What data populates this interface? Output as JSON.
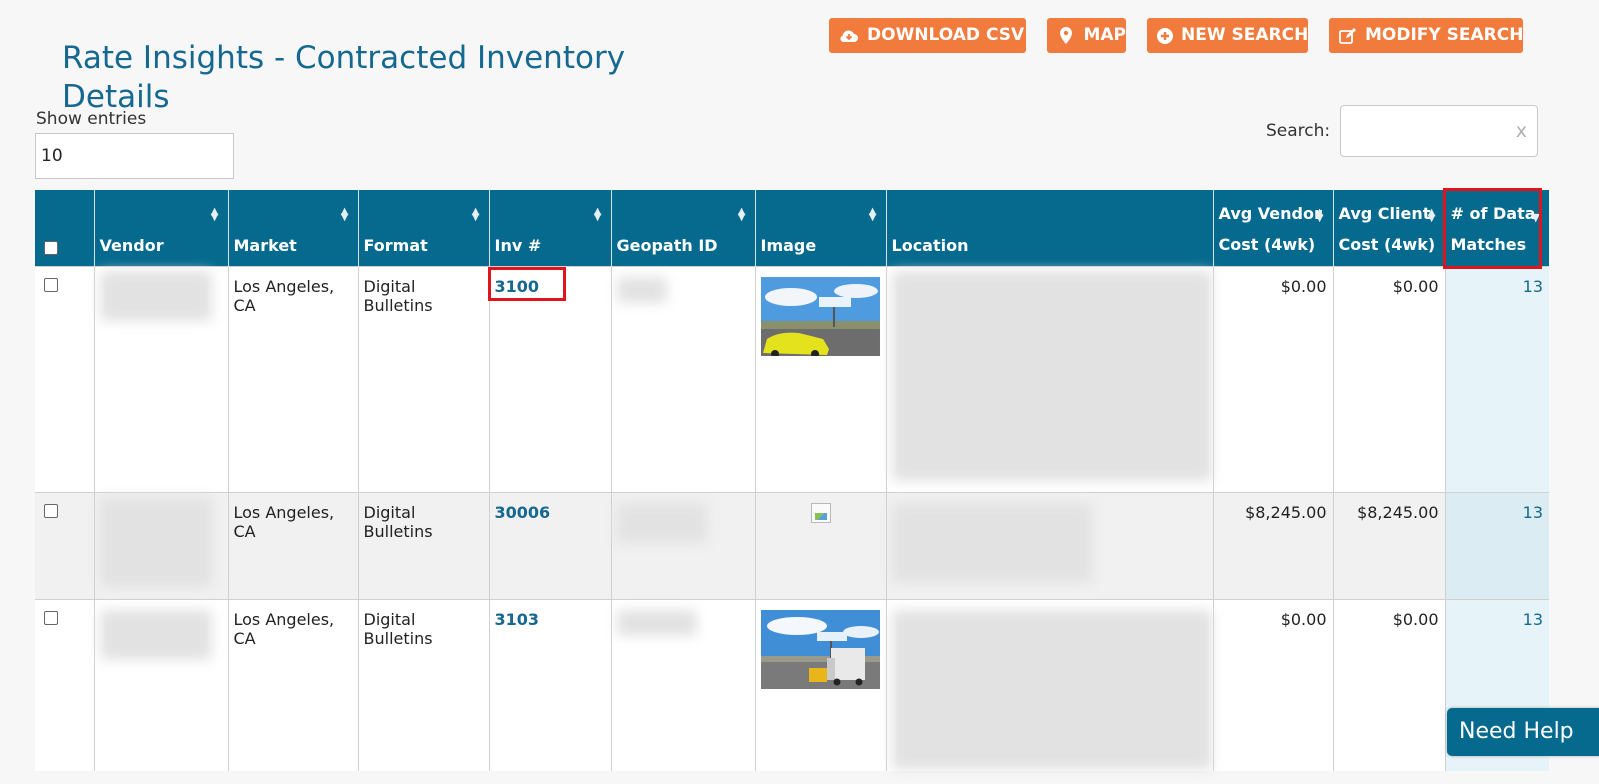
{
  "page": {
    "title": "Rate Insights - Contracted Inventory Details"
  },
  "toolbar": {
    "download_csv": "DOWNLOAD CSV",
    "map": "MAP",
    "new_search": "NEW SEARCH",
    "modify_search": "MODIFY SEARCH"
  },
  "controls": {
    "show_entries_label": "Show entries",
    "entries_value": "10",
    "search_label": "Search:",
    "search_value": "",
    "search_clear": "x"
  },
  "table": {
    "columns": {
      "vendor": "Vendor",
      "market": "Market",
      "format": "Format",
      "inv": "Inv #",
      "geopath": "Geopath ID",
      "image": "Image",
      "location": "Location",
      "avg_vendor_cost_1": "Avg Vendor",
      "avg_vendor_cost_2": "Cost (4wk)",
      "avg_client_cost_1": "Avg Client",
      "avg_client_cost_2": "Cost (4wk)",
      "matches_1": "# of Data",
      "matches_2": "Matches"
    },
    "rows": [
      {
        "market": "Los Angeles, CA",
        "format": "Digital Bulletins",
        "inv": "3100",
        "image": "billboard-photo",
        "avg_vendor_cost": "$0.00",
        "avg_client_cost": "$0.00",
        "matches": "13"
      },
      {
        "market": "Los Angeles, CA",
        "format": "Digital Bulletins",
        "inv": "30006",
        "image": "broken-image",
        "avg_vendor_cost": "$8,245.00",
        "avg_client_cost": "$8,245.00",
        "matches": "13"
      },
      {
        "market": "Los Angeles, CA",
        "format": "Digital Bulletins",
        "inv": "3103",
        "image": "billboard-photo",
        "avg_vendor_cost": "$0.00",
        "avg_client_cost": "$0.00",
        "matches": "13"
      }
    ]
  },
  "help": {
    "label": "Need Help"
  },
  "colors": {
    "accent": "#f07b3c",
    "header": "#066a8f",
    "highlight": "#e0141c",
    "link": "#15688f"
  }
}
